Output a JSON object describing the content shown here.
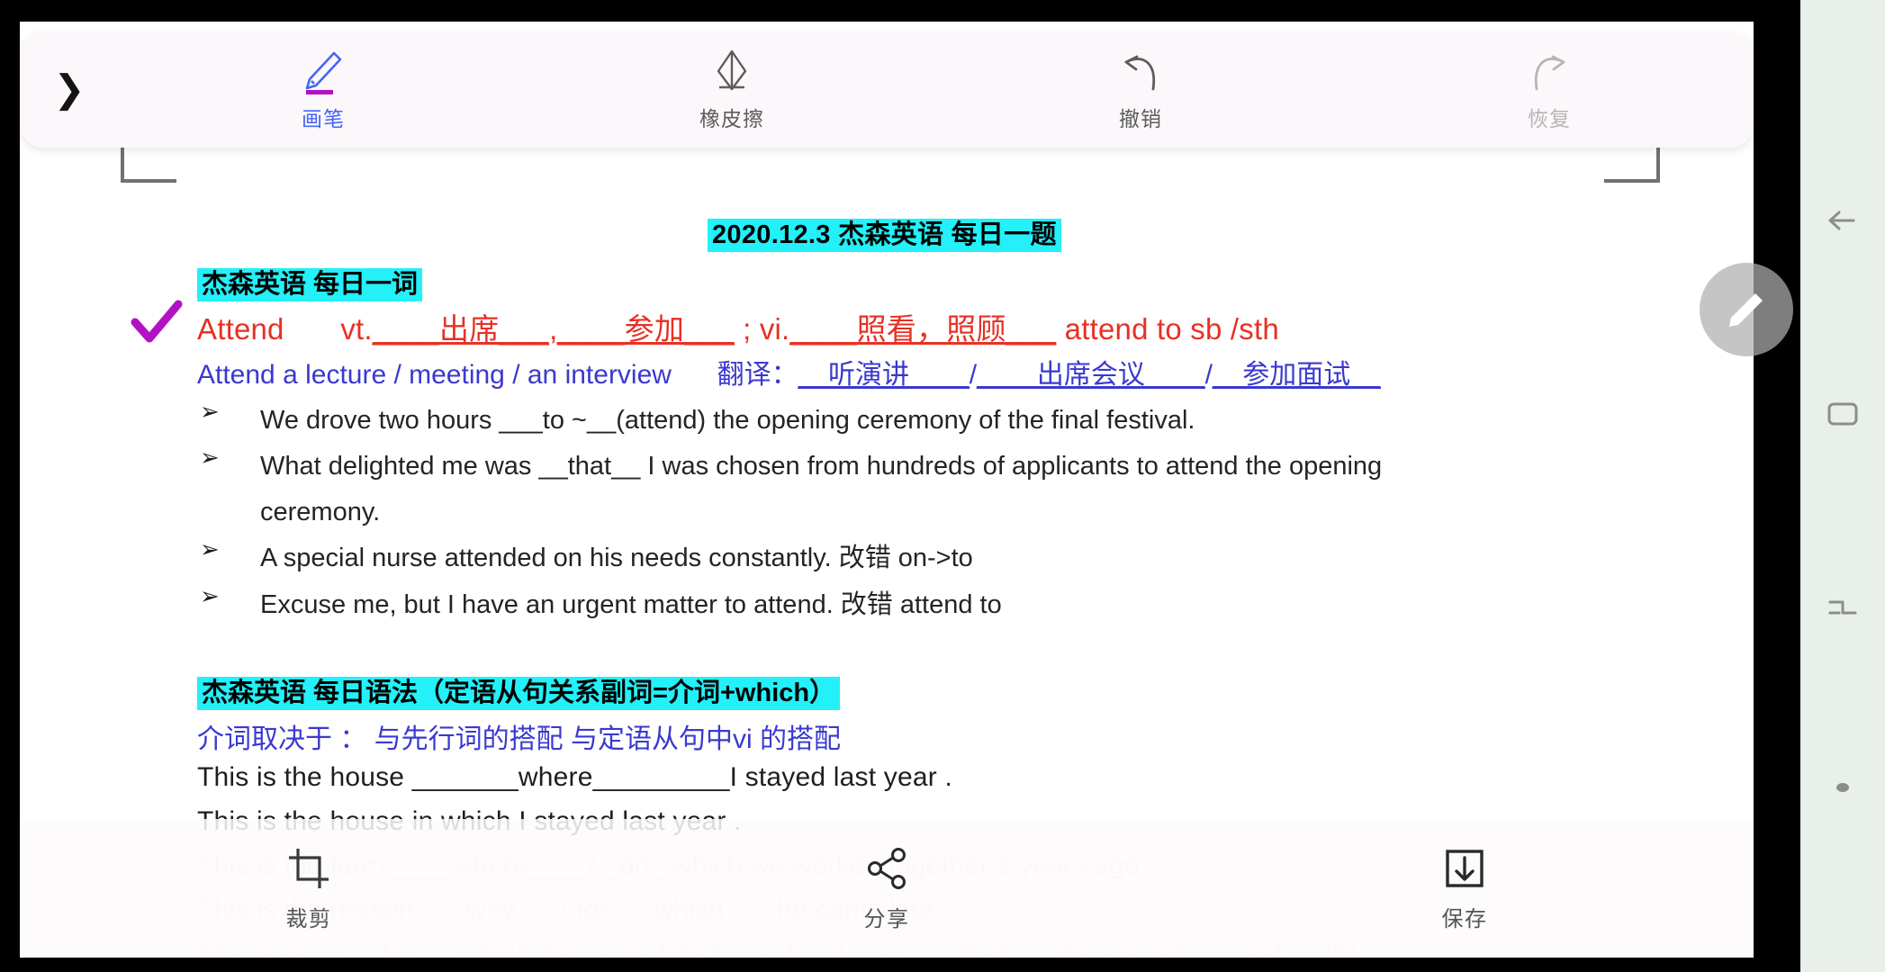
{
  "toolbar": {
    "expand_icon": "chevron-right-icon",
    "items": [
      {
        "label": "画笔",
        "icon": "pen-icon",
        "state": "active"
      },
      {
        "label": "橡皮擦",
        "icon": "eraser-icon",
        "state": "normal"
      },
      {
        "label": "撤销",
        "icon": "undo-icon",
        "state": "normal"
      },
      {
        "label": "恢复",
        "icon": "redo-icon",
        "state": "disabled"
      }
    ]
  },
  "bottombar": {
    "items": [
      {
        "label": "裁剪",
        "icon": "crop-icon"
      },
      {
        "label": "分享",
        "icon": "share-icon"
      },
      {
        "label": "保存",
        "icon": "save-download-icon"
      }
    ]
  },
  "fab": {
    "icon": "pen-edit-icon"
  },
  "navbar": {
    "items": [
      {
        "icon": "back-arrow-icon"
      },
      {
        "icon": "home-square-icon"
      },
      {
        "icon": "recents-icon"
      },
      {
        "icon": "dot-indicator-icon"
      }
    ]
  },
  "document": {
    "title": "2020.12.3  杰森英语  每日一题",
    "section1_heading": "杰森英语  每日一词",
    "word_entry": {
      "headword": "Attend",
      "vt_label": "vt.",
      "vt_blank1": "____出席___,",
      "vt_blank2": "____参加___",
      "sep": " ; ",
      "vi_label": "vi.",
      "vi_blank": "____照看，照顾___",
      "phrase": " attend to sb /sth"
    },
    "collocation": {
      "english": "Attend a lecture / meeting / an interview",
      "translate_label": "翻译：",
      "t1": "__听演讲____",
      "slash1": "/",
      "t2": "____出席会议____",
      "slash2": "/",
      "t3": "__参加面试__"
    },
    "examples": [
      {
        "marker": "➢",
        "text": "We drove two hours ___to ~__(attend) the opening ceremony of the final festival."
      },
      {
        "marker": "➢",
        "text": "What delighted me was __that__ I was chosen from hundreds of applicants to attend the opening"
      },
      {
        "marker": "",
        "text": "ceremony."
      },
      {
        "marker": "➢",
        "text": "A special nurse attended on his needs constantly.  改错        on->to"
      },
      {
        "marker": "➢",
        "text": "Excuse me, but I have an urgent matter to attend.  改错        attend to"
      }
    ],
    "section2_heading": "杰森英语  每日语法（定语从句关系副词=介词+which）",
    "grammar_rule": "介词取决于 ：  与先行词的搭配          与定语从句中vi 的搭配",
    "grammar_examples": [
      "This is the house _______where_________I stayed last year .",
      "This is the house in            which             I stayed last year .",
      "This is the farm ____where____/ _on_ which we worked together 2 years ago .",
      "This is the reason ___why___/ for___which___ he came late"
    ],
    "grammar_example_faded_red": "The reason __for__ which he came late for school was ___that___ he stayed up last night"
  },
  "colors": {
    "highlight": "#23f0f8",
    "red_text": "#e83024",
    "blue_text": "#3a39cf",
    "accent_blue": "#4466f5",
    "pen_underline": "#b312c4"
  }
}
